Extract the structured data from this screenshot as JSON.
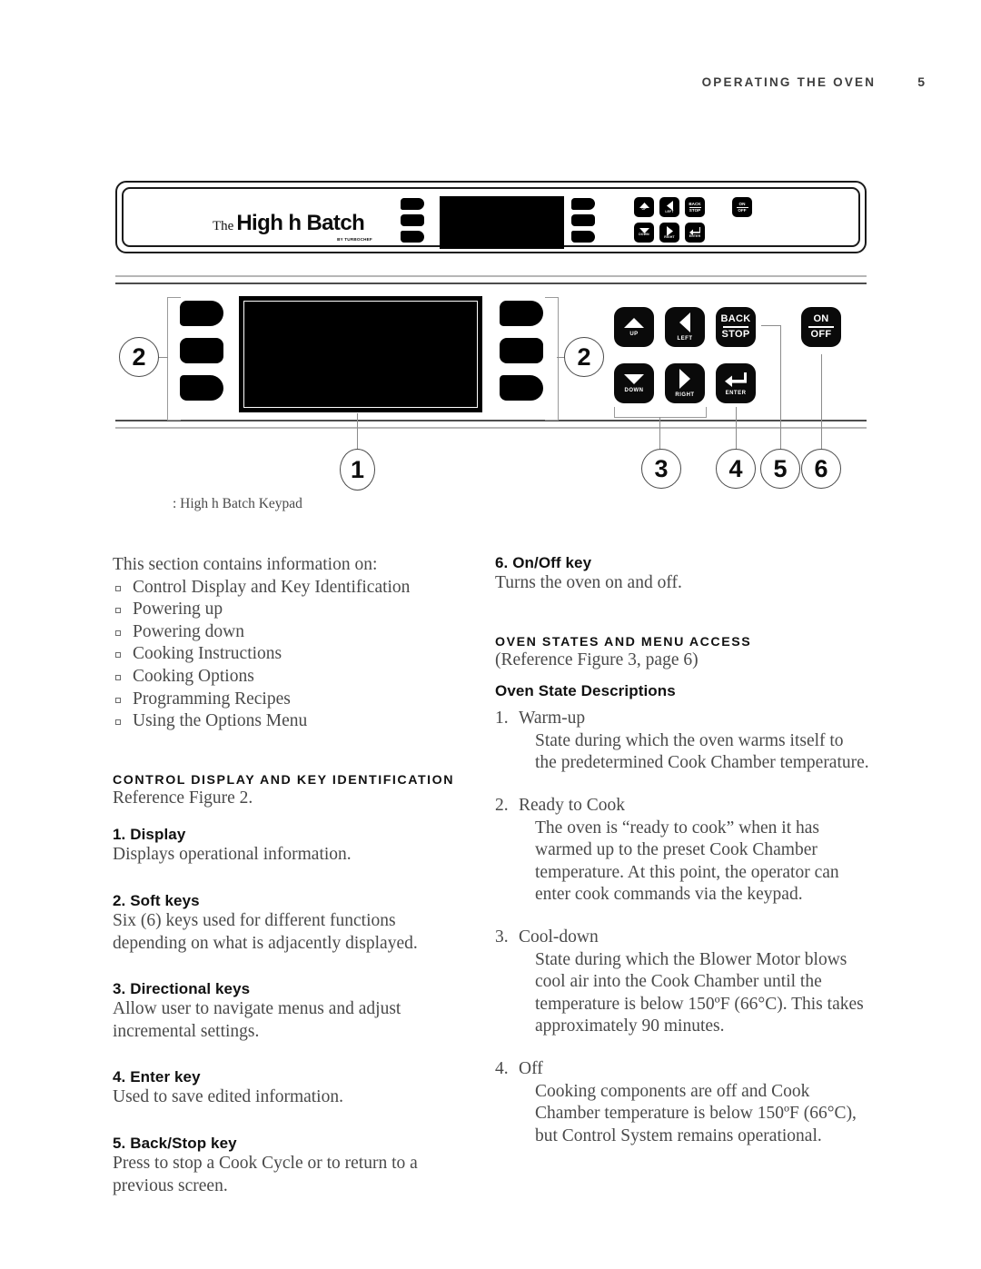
{
  "header": {
    "title": "OPERATING THE OVEN",
    "page_number": "5"
  },
  "figure": {
    "brand": {
      "the": "The",
      "name": "High h Batch",
      "sub": "BY TURBOCHEF"
    },
    "caption": ": High h Batch Keypad",
    "callouts": {
      "display": "1",
      "softkeys_left": "2",
      "softkeys_right": "2",
      "directional": "3",
      "enter": "4",
      "backstop": "5",
      "onoff": "6"
    },
    "keys": {
      "up": "UP",
      "down": "DOWN",
      "left": "LEFT",
      "right": "RIGHT",
      "back": "BACK",
      "stop": "STOP",
      "enter": "ENTER",
      "on": "ON",
      "off": "OFF"
    }
  },
  "left_column": {
    "intro": "This section contains information on:",
    "bullets": [
      "Control Display and Key Identification",
      "Powering up",
      "Powering down",
      "Cooking Instructions",
      "Cooking Options",
      "Programming Recipes",
      "Using the Options Menu"
    ],
    "section_heading": "CONTROL DISPLAY AND KEY IDENTIFICATION",
    "section_reference": "Reference Figure 2.",
    "items": [
      {
        "heading": "1.  Display",
        "body": "Displays operational information."
      },
      {
        "heading": "2. Soft keys",
        "body": "Six (6) keys used for different functions depending on what is adjacently displayed."
      },
      {
        "heading": "3. Directional keys",
        "body": "Allow user to navigate menus and adjust incremental settings."
      },
      {
        "heading": "4. Enter key",
        "body": "Used to save edited information."
      },
      {
        "heading": "5. Back/Stop key",
        "body": "Press to stop a Cook Cycle or to return to a previous screen."
      }
    ]
  },
  "right_column": {
    "item6": {
      "heading": "6. On/Off key",
      "body": "Turns the oven on and off."
    },
    "section_heading": "OVEN STATES AND MENU ACCESS",
    "section_reference": "(Reference Figure 3, page 6)",
    "sub_heading": "Oven State Descriptions",
    "states": [
      {
        "number": "1.",
        "name": "Warm-up",
        "description": "State during which the oven warms itself to the predetermined Cook Chamber temperature."
      },
      {
        "number": "2.",
        "name": "Ready to Cook",
        "description": "The oven is “ready to cook” when it has warmed up to the preset Cook Chamber temperature. At this point, the operator can enter cook commands via the keypad."
      },
      {
        "number": "3.",
        "name": "Cool-down",
        "description": "State during which the Blower Motor blows cool air into the Cook Chamber until the temperature is below 150ºF (66°C). This takes approximately 90 minutes."
      },
      {
        "number": "4.",
        "name": "Off",
        "description": "Cooking components are off and Cook Chamber temperature is below 150ºF (66°C), but Control System remains operational."
      }
    ]
  }
}
